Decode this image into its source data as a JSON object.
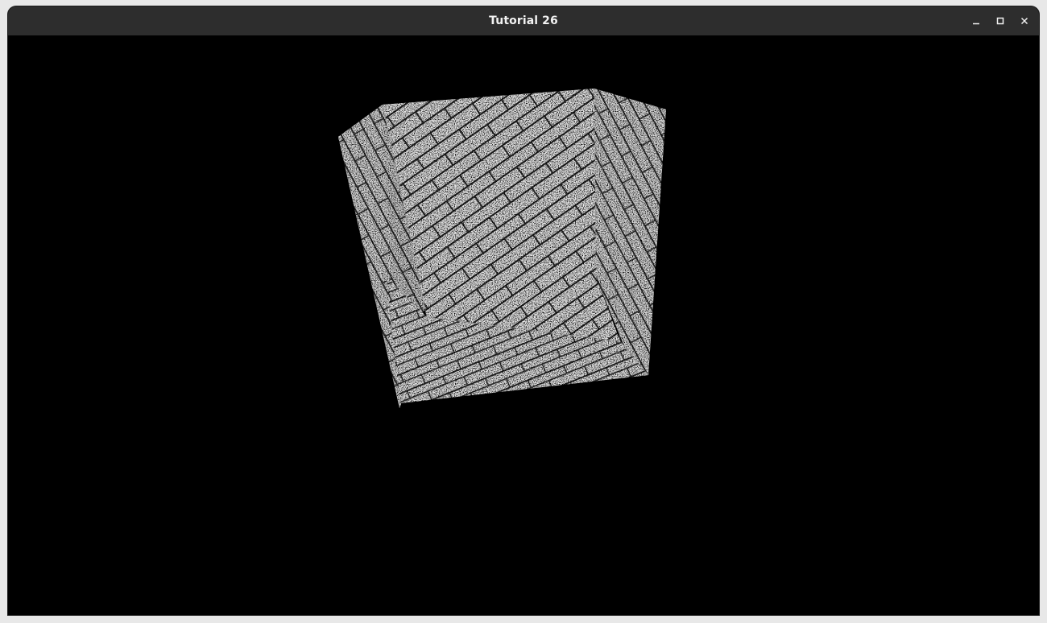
{
  "window": {
    "title": "Tutorial 26",
    "controls": {
      "minimize": "minimize-icon",
      "maximize": "maximize-icon",
      "close": "close-icon"
    }
  },
  "viewport": {
    "background": "#000000",
    "object": "textured-cube",
    "texture": "brick-pavement"
  },
  "colors": {
    "titlebar": "#2d2d2d",
    "title_text": "#f2f2f2",
    "texture_light": "#eeeeee",
    "texture_mortar": "#1f1f1f"
  }
}
